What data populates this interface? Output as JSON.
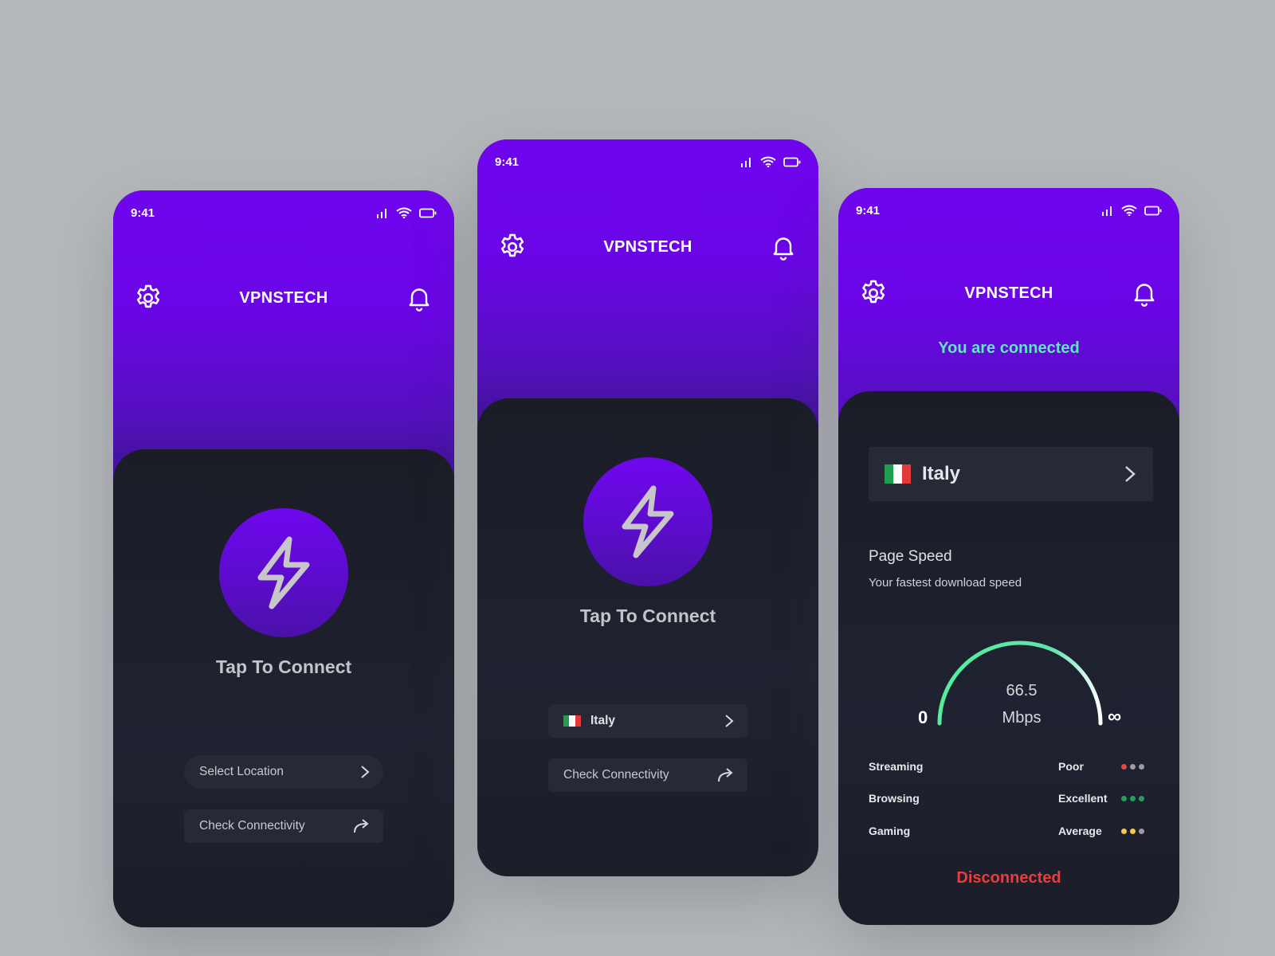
{
  "screens": [
    {
      "status_time": "9:41",
      "brand": "VPNSTECH",
      "tap_label": "Tap To Connect",
      "location_button": "Select Location",
      "check_button": "Check Connectivity"
    },
    {
      "status_time": "9:41",
      "brand": "VPNSTECH",
      "tap_label": "Tap To Connect",
      "location_button": "Italy",
      "check_button": "Check Connectivity"
    },
    {
      "status_time": "9:41",
      "brand": "VPNSTECH",
      "connection_status": "You are connected",
      "country": "Italy",
      "speed_title": "Page Speed",
      "speed_subtitle": "Your fastest download speed",
      "gauge": {
        "min_label": "0",
        "max_label": "∞",
        "value": "66.5",
        "unit": "Mbps"
      },
      "quality": [
        {
          "label": "Streaming",
          "rating": "Poor",
          "dots": [
            "#e84545",
            "#9a9aa0",
            "#9a9aa0"
          ]
        },
        {
          "label": "Browsing",
          "rating": "Excellent",
          "dots": [
            "#1ea35a",
            "#1ea35a",
            "#1ea35a"
          ]
        },
        {
          "label": "Gaming",
          "rating": "Average",
          "dots": [
            "#f2c94c",
            "#f2c94c",
            "#9a9aa0"
          ]
        }
      ],
      "footer_status": "Disconnected"
    }
  ],
  "colors": {
    "accent": "#6f05ee",
    "connected": "#5ee8c0",
    "disconnected": "#ec3b3b",
    "flag_italy": [
      "#1f9d4e",
      "#ffffff",
      "#e23a3a"
    ]
  },
  "icons": [
    "gear-icon",
    "bell-icon",
    "lightning-icon",
    "chevron-right-icon",
    "share-arrow-icon",
    "signal-icon",
    "wifi-icon",
    "battery-icon",
    "italy-flag-icon"
  ]
}
